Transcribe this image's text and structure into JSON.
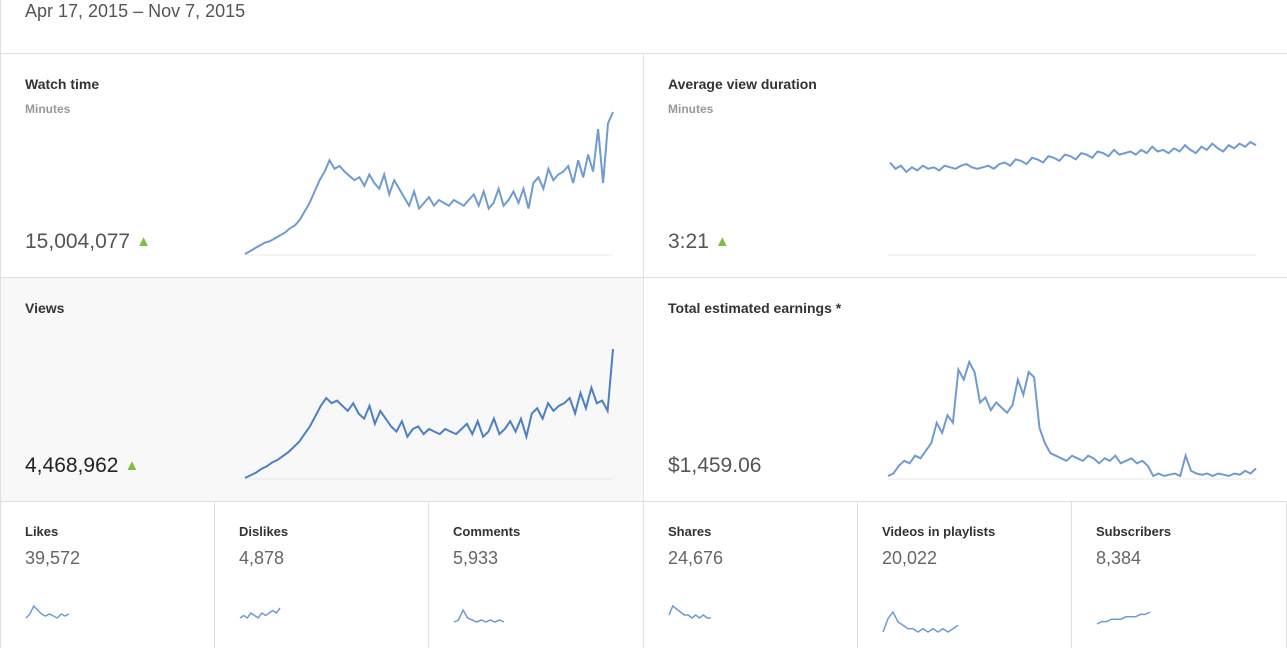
{
  "header": {
    "date_range": "Apr 17, 2015 – Nov 7, 2015"
  },
  "colors": {
    "line": "#6f9bd1",
    "line_selected": "#4c7fc4",
    "up_arrow": "#7ac143",
    "divider": "#e0e0e0"
  },
  "cards": {
    "watch_time": {
      "title": "Watch time",
      "subtitle": "Minutes",
      "value": "15,004,077",
      "trend": "▲",
      "trend_icon": "up-arrow-icon"
    },
    "avg_view_duration": {
      "title": "Average view duration",
      "subtitle": "Minutes",
      "value": "3:21",
      "trend": "▲",
      "trend_icon": "up-arrow-icon"
    },
    "views": {
      "title": "Views",
      "value": "4,468,962",
      "trend": "▲",
      "trend_icon": "up-arrow-icon",
      "selected": true
    },
    "earnings": {
      "title": "Total estimated earnings *",
      "value": "$1,459.06"
    }
  },
  "small_metrics": [
    {
      "title": "Likes",
      "value": "39,572"
    },
    {
      "title": "Dislikes",
      "value": "4,878"
    },
    {
      "title": "Comments",
      "value": "5,933"
    },
    {
      "title": "Shares",
      "value": "24,676"
    },
    {
      "title": "Videos in playlists",
      "value": "20,022"
    },
    {
      "title": "Subscribers",
      "value": "8,384"
    }
  ],
  "sparklines": {
    "watch_time": [
      0,
      2,
      4,
      6,
      8,
      9,
      11,
      13,
      15,
      18,
      20,
      24,
      30,
      36,
      44,
      52,
      58,
      66,
      60,
      62,
      58,
      55,
      52,
      54,
      48,
      56,
      50,
      46,
      56,
      42,
      52,
      46,
      40,
      34,
      44,
      32,
      36,
      40,
      34,
      38,
      36,
      34,
      38,
      36,
      34,
      38,
      42,
      34,
      44,
      32,
      36,
      46,
      34,
      38,
      44,
      36,
      46,
      32,
      50,
      54,
      46,
      60,
      52,
      56,
      58,
      62,
      50,
      66,
      54,
      70,
      58,
      88,
      50,
      92,
      100
    ],
    "avg_view_duration": [
      80,
      76,
      78,
      74,
      77,
      75,
      78,
      76,
      77,
      75,
      78,
      77,
      76,
      78,
      79,
      77,
      76,
      77,
      78,
      76,
      79,
      80,
      78,
      82,
      81,
      79,
      83,
      82,
      80,
      84,
      83,
      81,
      85,
      84,
      82,
      86,
      85,
      83,
      87,
      86,
      84,
      88,
      85,
      86,
      87,
      85,
      88,
      86,
      90,
      87,
      88,
      86,
      89,
      87,
      91,
      88,
      86,
      90,
      88,
      92,
      89,
      87,
      91,
      89,
      92,
      90,
      93,
      91
    ],
    "views": [
      0,
      2,
      4,
      7,
      9,
      12,
      14,
      17,
      20,
      24,
      28,
      34,
      40,
      48,
      56,
      62,
      58,
      60,
      56,
      52,
      58,
      50,
      46,
      56,
      42,
      52,
      46,
      40,
      36,
      44,
      32,
      38,
      40,
      34,
      38,
      36,
      34,
      38,
      36,
      34,
      38,
      42,
      34,
      44,
      32,
      36,
      46,
      34,
      38,
      44,
      36,
      46,
      32,
      50,
      54,
      46,
      58,
      52,
      56,
      58,
      62,
      50,
      66,
      54,
      70,
      58,
      60,
      52,
      100
    ],
    "earnings": [
      2,
      4,
      10,
      14,
      12,
      18,
      16,
      22,
      28,
      44,
      36,
      50,
      44,
      86,
      78,
      92,
      84,
      60,
      64,
      54,
      60,
      56,
      52,
      58,
      78,
      66,
      84,
      80,
      40,
      28,
      20,
      18,
      16,
      14,
      18,
      16,
      14,
      18,
      16,
      12,
      16,
      14,
      18,
      12,
      14,
      16,
      12,
      14,
      10,
      2,
      4,
      2,
      3,
      4,
      2,
      18,
      6,
      4,
      3,
      4,
      2,
      4,
      3,
      2,
      4,
      3,
      6,
      4,
      8
    ]
  },
  "small_sparklines": {
    "likes": [
      4,
      6,
      10,
      8,
      6,
      5,
      6,
      5,
      4,
      6,
      5,
      6
    ],
    "dislikes": [
      4,
      5,
      4,
      6,
      5,
      4,
      6,
      5,
      6,
      7,
      6,
      8
    ],
    "comments": [
      2,
      3,
      8,
      4,
      3,
      2,
      3,
      2,
      3,
      2,
      3,
      2
    ],
    "shares": [
      6,
      9,
      8,
      7,
      6,
      6,
      5,
      6,
      5,
      6,
      5,
      5
    ],
    "playlists": [
      4,
      8,
      10,
      7,
      6,
      5,
      5,
      4,
      5,
      4,
      5,
      4,
      5,
      4,
      5,
      6
    ],
    "subscribers": [
      3,
      4,
      4,
      5,
      5,
      5,
      6,
      6,
      6,
      7,
      7,
      8
    ]
  }
}
